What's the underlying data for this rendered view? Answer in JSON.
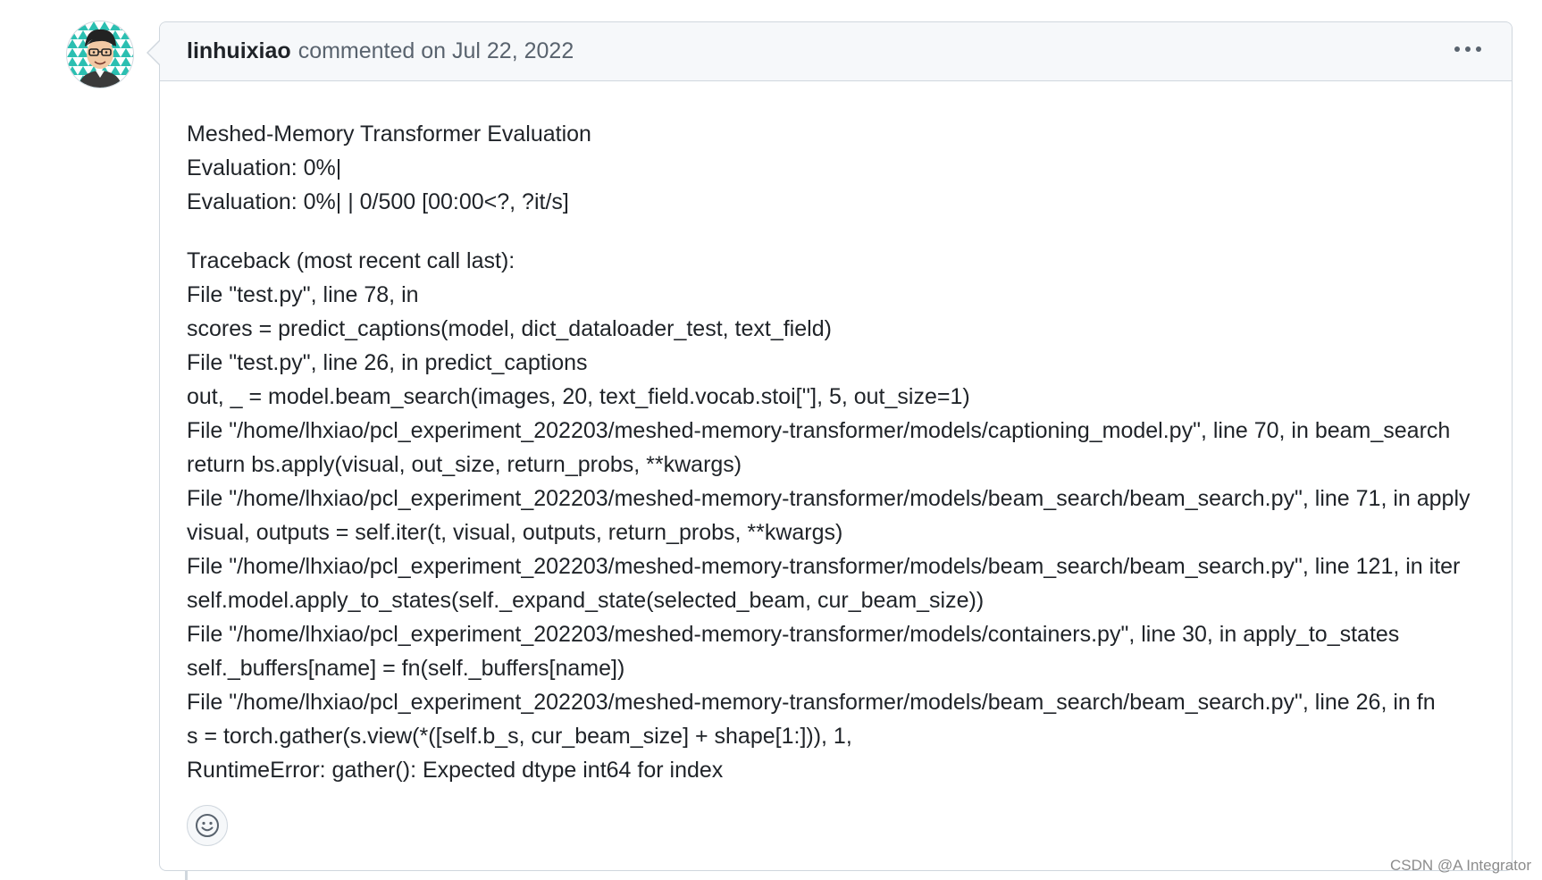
{
  "comment": {
    "author": "linhuixiao",
    "meta_text": "commented on Jul 22, 2022",
    "menu_icon": "kebab-horizontal-icon",
    "avatar_icon": "user-avatar-icon",
    "reaction_icon": "smiley-icon",
    "body_block1": [
      "Meshed-Memory Transformer Evaluation",
      "Evaluation: 0%|",
      "Evaluation: 0%| | 0/500 [00:00<?, ?it/s]"
    ],
    "body_block2": [
      "Traceback (most recent call last):",
      "File \"test.py\", line 78, in",
      "scores = predict_captions(model, dict_dataloader_test, text_field)",
      "File \"test.py\", line 26, in predict_captions",
      "out, _ = model.beam_search(images, 20, text_field.vocab.stoi[''], 5, out_size=1)",
      "File \"/home/lhxiao/pcl_experiment_202203/meshed-memory-transformer/models/captioning_model.py\", line 70, in beam_search",
      "return bs.apply(visual, out_size, return_probs, **kwargs)",
      "File \"/home/lhxiao/pcl_experiment_202203/meshed-memory-transformer/models/beam_search/beam_search.py\", line 71, in apply",
      "visual, outputs = self.iter(t, visual, outputs, return_probs, **kwargs)",
      "File \"/home/lhxiao/pcl_experiment_202203/meshed-memory-transformer/models/beam_search/beam_search.py\", line 121, in iter",
      "self.model.apply_to_states(self._expand_state(selected_beam, cur_beam_size))",
      "File \"/home/lhxiao/pcl_experiment_202203/meshed-memory-transformer/models/containers.py\", line 30, in apply_to_states",
      "self._buffers[name] = fn(self._buffers[name])",
      "File \"/home/lhxiao/pcl_experiment_202203/meshed-memory-transformer/models/beam_search/beam_search.py\", line 26, in fn",
      "s = torch.gather(s.view(*([self.b_s, cur_beam_size] + shape[1:])), 1,",
      "RuntimeError: gather(): Expected dtype int64 for index"
    ]
  },
  "watermark": "CSDN @A Integrator",
  "colors": {
    "header_bg": "#f6f8fa",
    "border": "#d0d7de",
    "muted_text": "#59636e",
    "text": "#1f2328",
    "avatar_teal": "#2bbfb1"
  }
}
